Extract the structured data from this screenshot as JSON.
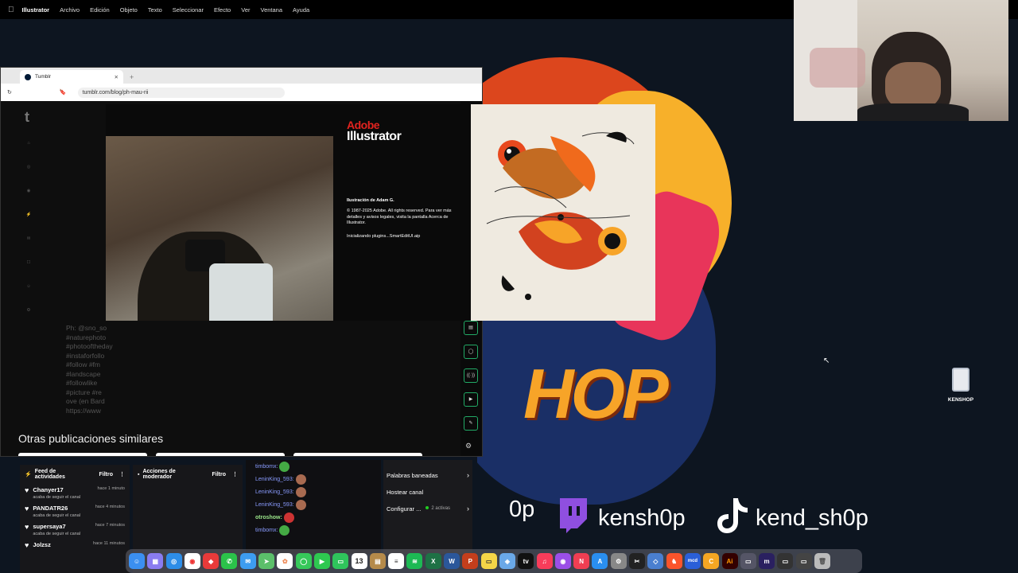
{
  "menubar": {
    "apple_icon": "apple-icon",
    "app_name": "Illustrator",
    "items": [
      "Archivo",
      "Edición",
      "Objeto",
      "Texto",
      "Seleccionar",
      "Efecto",
      "Ver",
      "Ventana",
      "Ayuda"
    ]
  },
  "browser": {
    "tab_title": "Tumblr",
    "url": "tumblr.com/blog/ph-mau-rii",
    "hashtags": [
      "Ph: @sno_so",
      "#naturephoto",
      "#photooftheday",
      "#instaforfollo",
      "#follow #fm",
      "#landscape",
      "#followlike",
      "#picture #re",
      "ove (en Bard",
      "https://www"
    ],
    "related_heading": "Otras publicaciones similares"
  },
  "splash": {
    "brand": "Adobe",
    "product": "Illustrator",
    "credit": "Ilustración de Adam G.",
    "copyright": "© 1987-2025 Adobe. All rights reserved. Para ver más detalles y avisos legales, visita la pantalla Acerca de Illustrator.",
    "loading": "Inicializando plugins...SmartEditUI.aip"
  },
  "wallpaper": {
    "shop_text": "HOP",
    "twitch_handle": "kensh0p",
    "tiktok_handle": "kend_sh0p",
    "partial_handle": "0p"
  },
  "desktop": {
    "icon_label": "KENSHOP"
  },
  "feed": {
    "title": "Feed de actividades",
    "filter": "Filtro",
    "items": [
      {
        "name": "Chanyer17",
        "time": "hace 1 minuto",
        "desc": "acaba de seguir el canal"
      },
      {
        "name": "PANDATR26",
        "time": "hace 4 minutos",
        "desc": "acaba de seguir el canal"
      },
      {
        "name": "supersaya7",
        "time": "hace 7 minutos",
        "desc": "acaba de seguir el canal"
      },
      {
        "name": "Jolzsz",
        "time": "hace 11 minutos",
        "desc": ""
      }
    ]
  },
  "mod": {
    "title": "Acciones de moderador",
    "filter": "Filtro"
  },
  "chat": {
    "lines": [
      {
        "user": "timbomx:",
        "type": "u"
      },
      {
        "user": "LeninKing_593:",
        "type": "u"
      },
      {
        "user": "LeninKing_593:",
        "type": "u"
      },
      {
        "user": "LeninKing_593:",
        "type": "u"
      },
      {
        "user": "otroshow:",
        "type": "g"
      },
      {
        "user": "timbomx:",
        "type": "u"
      }
    ]
  },
  "menu": {
    "items": [
      {
        "label": "Palabras baneadas",
        "sub": ""
      },
      {
        "label": "Hostear canal",
        "sub": ""
      },
      {
        "label": "Configurar ...",
        "sub": "2 activas"
      }
    ]
  },
  "dock": {
    "calendar_day": "13",
    "icons": [
      "finder-icon",
      "launchpad-icon",
      "safari-icon",
      "chrome-icon",
      "screens-icon",
      "whatsapp-icon",
      "mail-icon",
      "maps-icon",
      "photos-icon",
      "messages-icon",
      "facetime-icon",
      "messages2-icon",
      "calendar-icon",
      "notes-folder-icon",
      "reminders-icon",
      "spotify-icon",
      "excel-icon",
      "word-icon",
      "powerpoint-icon",
      "notes-icon",
      "preview-icon",
      "appletv-icon",
      "music-icon",
      "podcasts-icon",
      "news-icon",
      "appstore-icon",
      "settings-icon",
      "capcut-icon",
      "vpn-icon",
      "brave-icon",
      "mcd-icon",
      "cursor-icon",
      "illustrator-icon",
      "finder-window-icon",
      "marker-icon",
      "window1-icon",
      "window2-icon",
      "trash-icon"
    ]
  }
}
